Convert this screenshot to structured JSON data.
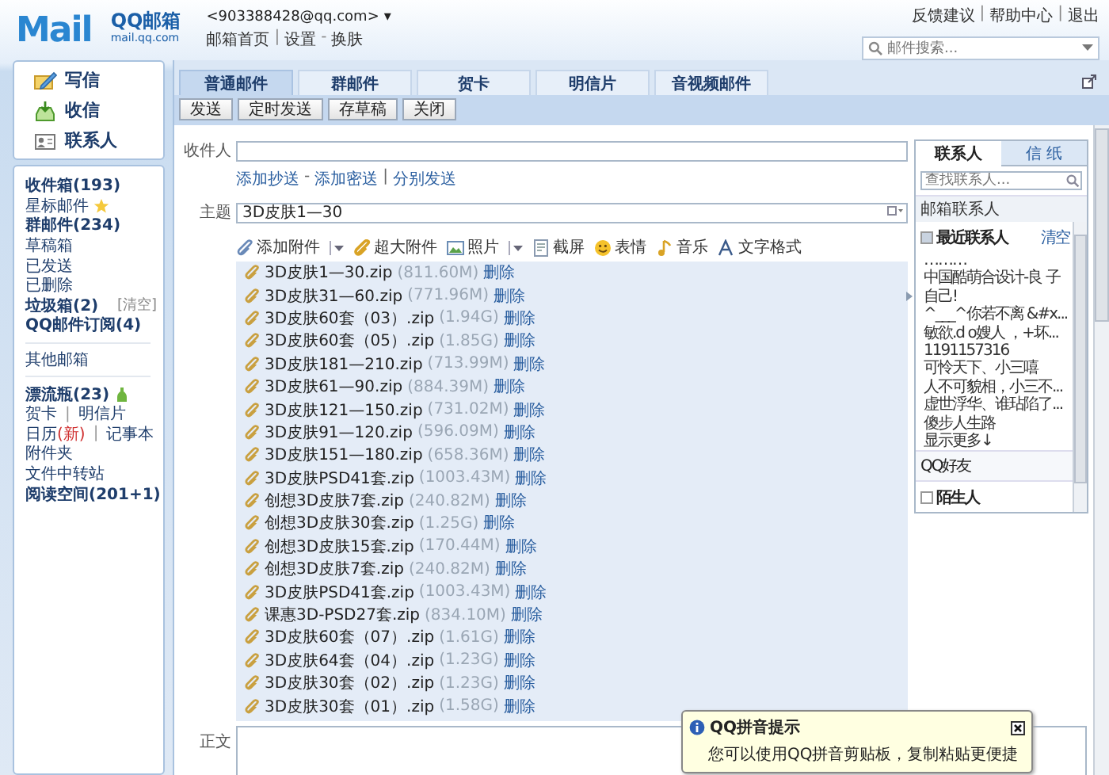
{
  "header": {
    "logo": "Mail",
    "brand": "QQ邮箱",
    "domain": "mail.qq.com",
    "account": "<903388428@qq.com>",
    "account_caret": "▾",
    "links": [
      "邮箱首页",
      "设置",
      "换肤"
    ],
    "link_separators": [
      "|",
      "-"
    ],
    "top_links": [
      "反馈建议",
      "帮助中心",
      "退出"
    ],
    "top_separators": [
      "|",
      "|"
    ],
    "search": {
      "placeholder": "邮件搜索..."
    }
  },
  "sidebar": {
    "actions": [
      {
        "label": "写信",
        "kind": "write"
      },
      {
        "label": "收信",
        "kind": "inbox"
      },
      {
        "label": "联系人",
        "kind": "contacts"
      }
    ],
    "groups": [
      [
        {
          "label": "收件箱(193)",
          "bold": true,
          "kind": "folder"
        },
        {
          "label": "星标邮件",
          "bold": false,
          "kind": "starred"
        },
        {
          "label": "群邮件(234)",
          "bold": true,
          "kind": "folder"
        },
        {
          "label": "草稿箱",
          "bold": false,
          "kind": "folder"
        },
        {
          "label": "已发送",
          "bold": false,
          "kind": "folder"
        },
        {
          "label": "已删除",
          "bold": false,
          "kind": "folder"
        },
        {
          "label": "垃圾箱(2)",
          "bold": true,
          "kind": "trash",
          "action": "[清空]"
        },
        {
          "label": "QQ邮件订阅(4)",
          "bold": true,
          "kind": "folder"
        }
      ],
      [
        {
          "label": "其他邮箱",
          "bold": false,
          "kind": "folder"
        }
      ],
      [
        {
          "label": "漂流瓶(23)",
          "bold": true,
          "kind": "bottle"
        },
        {
          "label": "贺卡",
          "bold": false,
          "kind": "pair",
          "sep": "|",
          "pair": "明信片"
        },
        {
          "label": "日历",
          "note": "(新)",
          "bold": false,
          "kind": "pair",
          "sep": "|",
          "pair": "记事本"
        },
        {
          "label": "附件夹",
          "bold": false,
          "kind": "folder"
        },
        {
          "label": "文件中转站",
          "bold": false,
          "kind": "folder"
        },
        {
          "label": "阅读空间(201+1)",
          "bold": true,
          "kind": "folder"
        }
      ]
    ]
  },
  "compose": {
    "tabs": [
      {
        "label": "普通邮件",
        "selected": true
      },
      {
        "label": "群邮件",
        "selected": false
      },
      {
        "label": "贺卡",
        "selected": false
      },
      {
        "label": "明信片",
        "selected": false
      },
      {
        "label": "音视频邮件",
        "selected": false
      }
    ],
    "buttons": [
      "发送",
      "定时发送",
      "存草稿",
      "关闭"
    ],
    "to": {
      "label": "收件人"
    },
    "recipient_links": [
      "添加抄送",
      "添加密送",
      "分别发送"
    ],
    "recipient_separators": [
      "-",
      "|"
    ],
    "subject": {
      "label": "主题",
      "value": "3D皮肤1—30"
    },
    "toolbar": [
      {
        "label": "添加附件",
        "kind": "attach",
        "menu": true
      },
      {
        "label": "超大附件",
        "kind": "bigattach",
        "menu": false
      },
      {
        "label": "照片",
        "kind": "photo",
        "menu": true
      },
      {
        "label": "截屏",
        "kind": "screenshot",
        "menu": false
      },
      {
        "label": "表情",
        "kind": "emoji",
        "menu": false
      },
      {
        "label": "音乐",
        "kind": "music",
        "menu": false
      },
      {
        "label": "文字格式",
        "kind": "format",
        "menu": false
      }
    ],
    "attachments": [
      {
        "name": "3D皮肤1—30.zip",
        "size": "(811.60M)",
        "action": "删除"
      },
      {
        "name": "3D皮肤31—60.zip",
        "size": "(771.96M)",
        "action": "删除"
      },
      {
        "name": "3D皮肤60套（03）.zip",
        "size": "(1.94G)",
        "action": "删除"
      },
      {
        "name": "3D皮肤60套（05）.zip",
        "size": "(1.85G)",
        "action": "删除"
      },
      {
        "name": "3D皮肤181—210.zip",
        "size": "(713.99M)",
        "action": "删除"
      },
      {
        "name": "3D皮肤61—90.zip",
        "size": "(884.39M)",
        "action": "删除"
      },
      {
        "name": "3D皮肤121—150.zip",
        "size": "(731.02M)",
        "action": "删除"
      },
      {
        "name": "3D皮肤91—120.zip",
        "size": "(596.09M)",
        "action": "删除"
      },
      {
        "name": "3D皮肤151—180.zip",
        "size": "(658.36M)",
        "action": "删除"
      },
      {
        "name": "3D皮肤PSD41套.zip",
        "size": "(1003.43M)",
        "action": "删除"
      },
      {
        "name": "创想3D皮肤7套.zip",
        "size": "(240.82M)",
        "action": "删除"
      },
      {
        "name": "创想3D皮肤30套.zip",
        "size": "(1.25G)",
        "action": "删除"
      },
      {
        "name": "创想3D皮肤15套.zip",
        "size": "(170.44M)",
        "action": "删除"
      },
      {
        "name": "创想3D皮肤7套.zip",
        "size": "(240.82M)",
        "action": "删除"
      },
      {
        "name": "3D皮肤PSD41套.zip",
        "size": "(1003.43M)",
        "action": "删除"
      },
      {
        "name": "课惠3D-PSD27套.zip",
        "size": "(834.10M)",
        "action": "删除"
      },
      {
        "name": "3D皮肤60套（07）.zip",
        "size": "(1.61G)",
        "action": "删除"
      },
      {
        "name": "3D皮肤64套（04）.zip",
        "size": "(1.23G)",
        "action": "删除"
      },
      {
        "name": "3D皮肤30套（02）.zip",
        "size": "(1.23G)",
        "action": "删除"
      },
      {
        "name": "3D皮肤30套（01）.zip",
        "size": "(1.58G)",
        "action": "删除"
      }
    ],
    "body": {
      "label": "正文"
    }
  },
  "contacts": {
    "tabs": [
      {
        "label": "联系人",
        "selected": true
      },
      {
        "label": "信 纸",
        "selected": false
      }
    ],
    "search": {
      "placeholder": "查找联系人..."
    },
    "section": "邮箱联系人",
    "groups": [
      {
        "label": "最近联系人",
        "kind": "group",
        "expanded": true,
        "action": "清空",
        "items": [
          "………",
          "中国酷萌合设计-良 子自己!",
          "^___^你若不离 &#x...",
          "敏欲.d o嫂人 ，+坏...",
          "1191157316",
          "可怜天下、小三嘻",
          "人不可貌相，小三不...",
          "虚世浮华、谁玷陷了...",
          "傻步人生路"
        ],
        "more": "显示更多↓"
      },
      {
        "label": "QQ好友",
        "kind": "plain"
      },
      {
        "label": "陌生人",
        "kind": "group",
        "expanded": false
      }
    ]
  },
  "tip": {
    "title": "QQ拼音提示",
    "text": "您可以使用QQ拼音剪贴板，复制粘贴更便捷"
  }
}
